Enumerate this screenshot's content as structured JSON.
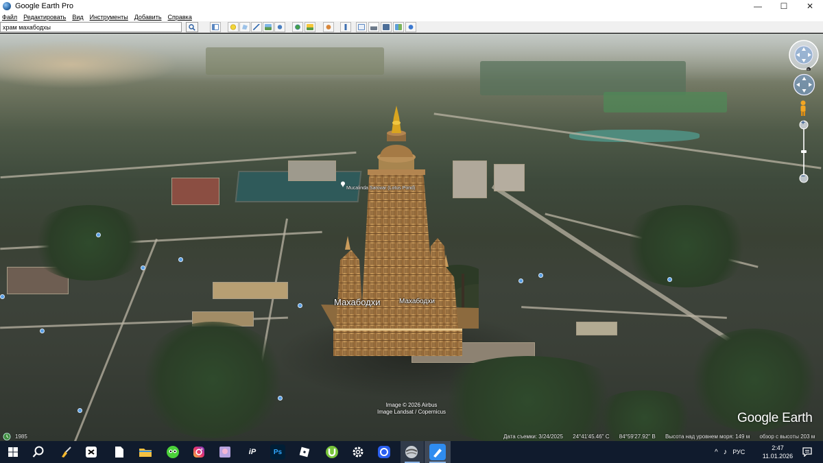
{
  "window": {
    "title": "Google Earth Pro",
    "controls": {
      "minimize": "—",
      "maximize": "☐",
      "close": "✕"
    }
  },
  "menu": [
    "Файл",
    "Редактировать",
    "Вид",
    "Инструменты",
    "Добавить",
    "Справка"
  ],
  "search": {
    "value": "храм махабодхы",
    "button_icon": "search-icon"
  },
  "toolbar": [
    "sidebar-icon",
    "placemark-icon",
    "polygon-icon",
    "path-icon",
    "image-overlay-icon",
    "record-tour-icon",
    "historical-imagery-icon",
    "sunlight-icon",
    "planets-icon",
    "ruler-icon",
    "email-icon",
    "print-icon",
    "save-image-icon",
    "map-view-icon",
    "view-in-maps-icon"
  ],
  "map": {
    "labels": {
      "main": "Махабодхи",
      "secondary": "Махабодхи",
      "place": "Mucalinda Sarovar (Lotus Pond)"
    },
    "credits": [
      "Image © 2026 Airbus",
      "Image Landsat / Copernicus"
    ],
    "brand": "Google Earth",
    "controls": [
      "look-joystick-icon",
      "move-joystick-icon",
      "pegman-icon",
      "zoom-slider"
    ],
    "zoom_in": "+",
    "zoom_out": "−",
    "compass_n": "N"
  },
  "status": {
    "year": "1985",
    "imagery_date": "Дата съемки: 3/24/2025",
    "lat": "24°41'45.46\" С",
    "lon": "84°59'27.92\" В",
    "elevation": "Высота над уровнем моря:  149 м",
    "eye_alt": "обзор с высоты   203 м"
  },
  "taskbar": {
    "apps": [
      "start-icon",
      "search-icon",
      "cleaner-icon",
      "capcut-icon",
      "notepad-icon",
      "explorer-icon",
      "ai-app-icon",
      "instagram-icon",
      "photo-app-icon",
      "ibis-paint-icon",
      "photoshop-icon",
      "roblox-icon",
      "utorrent-icon",
      "settings-icon",
      "video-editor-icon",
      "google-earth-icon",
      "blue-app-icon"
    ],
    "ps_label": "Ps",
    "ip_label": "iP",
    "lang": "РУС",
    "time": "2:47",
    "date": "11.01.2026",
    "sound_icon": "sound-icon",
    "chevron_icon": "chevron-up-icon",
    "notify_icon": "notification-icon"
  },
  "colors": {
    "taskbar_bg": "#101b2d",
    "accent": "#8db6e8",
    "temple": "#b5894e"
  }
}
